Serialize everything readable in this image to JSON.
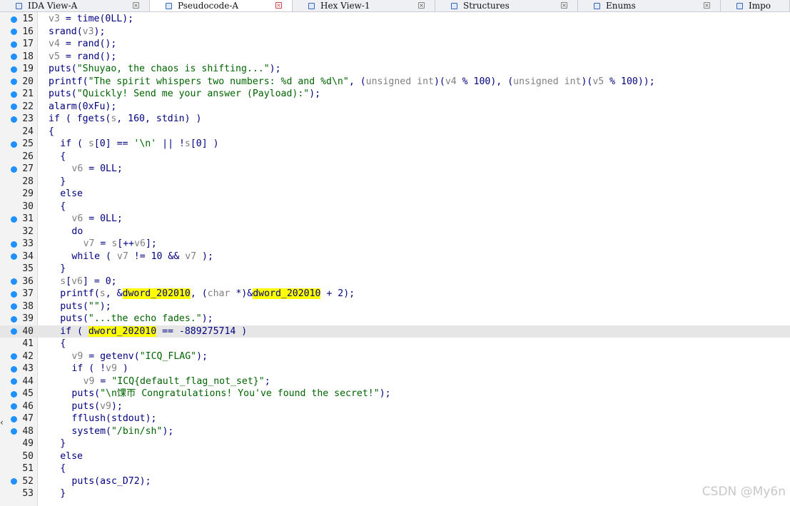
{
  "tabs": [
    {
      "label": "IDA View-A",
      "active": false,
      "icon": "graph-icon"
    },
    {
      "label": "Pseudocode-A",
      "active": true,
      "icon": "pseudocode-icon"
    },
    {
      "label": "Hex View-1",
      "active": false,
      "icon": "hex-icon"
    },
    {
      "label": "Structures",
      "active": false,
      "icon": "structures-icon"
    },
    {
      "label": "Enums",
      "active": false,
      "icon": "enums-icon"
    },
    {
      "label": "Impo",
      "active": false,
      "icon": "imports-icon"
    }
  ],
  "highlighted_line": 40,
  "highlight_token": "dword_202010",
  "code_lines": [
    {
      "num": "15",
      "dot": true,
      "indent": 0,
      "text": "v3 = time(0LL);"
    },
    {
      "num": "16",
      "dot": true,
      "indent": 0,
      "text": "srand(v3);"
    },
    {
      "num": "17",
      "dot": true,
      "indent": 0,
      "text": "v4 = rand();"
    },
    {
      "num": "18",
      "dot": true,
      "indent": 0,
      "text": "v5 = rand();"
    },
    {
      "num": "19",
      "dot": true,
      "indent": 0,
      "text": "puts(\"Shuyao, the chaos is shifting...\");"
    },
    {
      "num": "20",
      "dot": true,
      "indent": 0,
      "text": "printf(\"The spirit whispers two numbers: %d and %d\\n\", (unsigned int)(v4 % 100), (unsigned int)(v5 % 100));"
    },
    {
      "num": "21",
      "dot": true,
      "indent": 0,
      "text": "puts(\"Quickly! Send me your answer (Payload):\");"
    },
    {
      "num": "22",
      "dot": true,
      "indent": 0,
      "text": "alarm(0xFu);"
    },
    {
      "num": "23",
      "dot": true,
      "indent": 0,
      "text": "if ( fgets(s, 160, stdin) )"
    },
    {
      "num": "24",
      "dot": false,
      "indent": 0,
      "text": "{"
    },
    {
      "num": "25",
      "dot": true,
      "indent": 1,
      "text": "if ( s[0] == '\\n' || !s[0] )"
    },
    {
      "num": "26",
      "dot": false,
      "indent": 1,
      "text": "{"
    },
    {
      "num": "27",
      "dot": true,
      "indent": 2,
      "text": "v6 = 0LL;"
    },
    {
      "num": "28",
      "dot": false,
      "indent": 1,
      "text": "}"
    },
    {
      "num": "29",
      "dot": false,
      "indent": 1,
      "text": "else"
    },
    {
      "num": "30",
      "dot": false,
      "indent": 1,
      "text": "{"
    },
    {
      "num": "31",
      "dot": true,
      "indent": 2,
      "text": "v6 = 0LL;"
    },
    {
      "num": "32",
      "dot": false,
      "indent": 2,
      "text": "do"
    },
    {
      "num": "33",
      "dot": true,
      "indent": 3,
      "text": "v7 = s[++v6];"
    },
    {
      "num": "34",
      "dot": true,
      "indent": 2,
      "text": "while ( v7 != 10 && v7 );"
    },
    {
      "num": "35",
      "dot": false,
      "indent": 1,
      "text": "}"
    },
    {
      "num": "36",
      "dot": true,
      "indent": 1,
      "text": "s[v6] = 0;"
    },
    {
      "num": "37",
      "dot": true,
      "indent": 1,
      "text": "printf(s, &dword_202010, (char *)&dword_202010 + 2);"
    },
    {
      "num": "38",
      "dot": true,
      "indent": 1,
      "text": "puts(\"\");"
    },
    {
      "num": "39",
      "dot": true,
      "indent": 1,
      "text": "puts(\"...the echo fades.\");"
    },
    {
      "num": "40",
      "dot": true,
      "indent": 1,
      "text": "if ( dword_202010 == -889275714 )"
    },
    {
      "num": "41",
      "dot": false,
      "indent": 1,
      "text": "{"
    },
    {
      "num": "42",
      "dot": true,
      "indent": 2,
      "text": "v9 = getenv(\"ICQ_FLAG\");"
    },
    {
      "num": "43",
      "dot": true,
      "indent": 2,
      "text": "if ( !v9 )"
    },
    {
      "num": "44",
      "dot": true,
      "indent": 3,
      "text": "v9 = \"ICQ{default_flag_not_set}\";"
    },
    {
      "num": "45",
      "dot": true,
      "indent": 2,
      "text": "puts(\"\\n馃帀 Congratulations! You've found the secret!\");"
    },
    {
      "num": "46",
      "dot": true,
      "indent": 2,
      "text": "puts(v9);"
    },
    {
      "num": "47",
      "dot": true,
      "indent": 2,
      "text": "fflush(stdout);"
    },
    {
      "num": "48",
      "dot": true,
      "indent": 2,
      "text": "system(\"/bin/sh\");"
    },
    {
      "num": "49",
      "dot": false,
      "indent": 1,
      "text": "}"
    },
    {
      "num": "50",
      "dot": false,
      "indent": 1,
      "text": "else"
    },
    {
      "num": "51",
      "dot": false,
      "indent": 1,
      "text": "{"
    },
    {
      "num": "52",
      "dot": true,
      "indent": 2,
      "text": "puts(asc_D72);"
    },
    {
      "num": "53",
      "dot": false,
      "indent": 1,
      "text": "}"
    }
  ],
  "watermark": "CSDN @My6n",
  "colors": {
    "breakpoint_dot": "#1e90ff",
    "highlight": "#ffff00",
    "code": "#000080",
    "variable": "#808080",
    "string": "#006400"
  }
}
